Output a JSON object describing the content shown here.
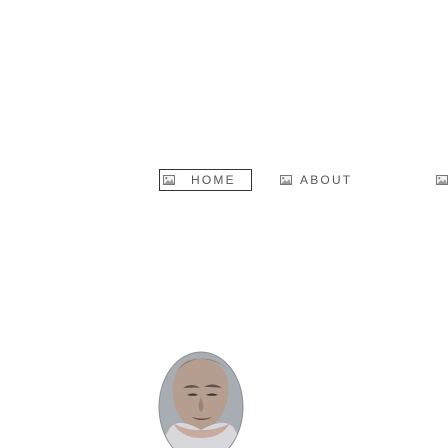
{
  "nav": {
    "items": [
      {
        "label": "HOME",
        "icon": "broken-image-icon",
        "active": true
      },
      {
        "label": "ABOUT",
        "icon": "broken-image-icon",
        "active": false
      }
    ]
  },
  "colors": {
    "text": "#555555",
    "active_border": "#333333",
    "background": "#ffffff"
  },
  "avatar": {
    "icon": "profile-avatar"
  }
}
